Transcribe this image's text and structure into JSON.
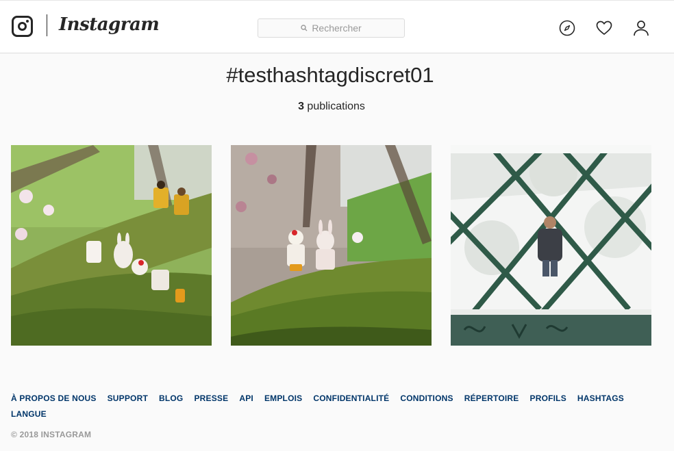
{
  "header": {
    "brand": "Instagram",
    "search_placeholder": "Rechercher",
    "icons": [
      "compass-icon",
      "heart-icon",
      "user-icon"
    ]
  },
  "hashtag": {
    "title": "#testhashtagdiscret01",
    "count": "3",
    "count_label": "publications"
  },
  "posts": [
    {
      "subject": "lego-figures-on-mossy-branch"
    },
    {
      "subject": "lego-figures-chicken-bunny-on-mossy-branch"
    },
    {
      "subject": "man-in-snow-behind-fence"
    }
  ],
  "footer": {
    "links": [
      "À PROPOS DE NOUS",
      "SUPPORT",
      "BLOG",
      "PRESSE",
      "API",
      "EMPLOIS",
      "CONFIDENTIALITÉ",
      "CONDITIONS",
      "RÉPERTOIRE",
      "PROFILS",
      "HASHTAGS",
      "LANGUE"
    ],
    "copyright": "© 2018 INSTAGRAM"
  },
  "colors": {
    "link": "#003569",
    "muted": "#999999",
    "text": "#262626",
    "border": "#dbdbdb"
  }
}
